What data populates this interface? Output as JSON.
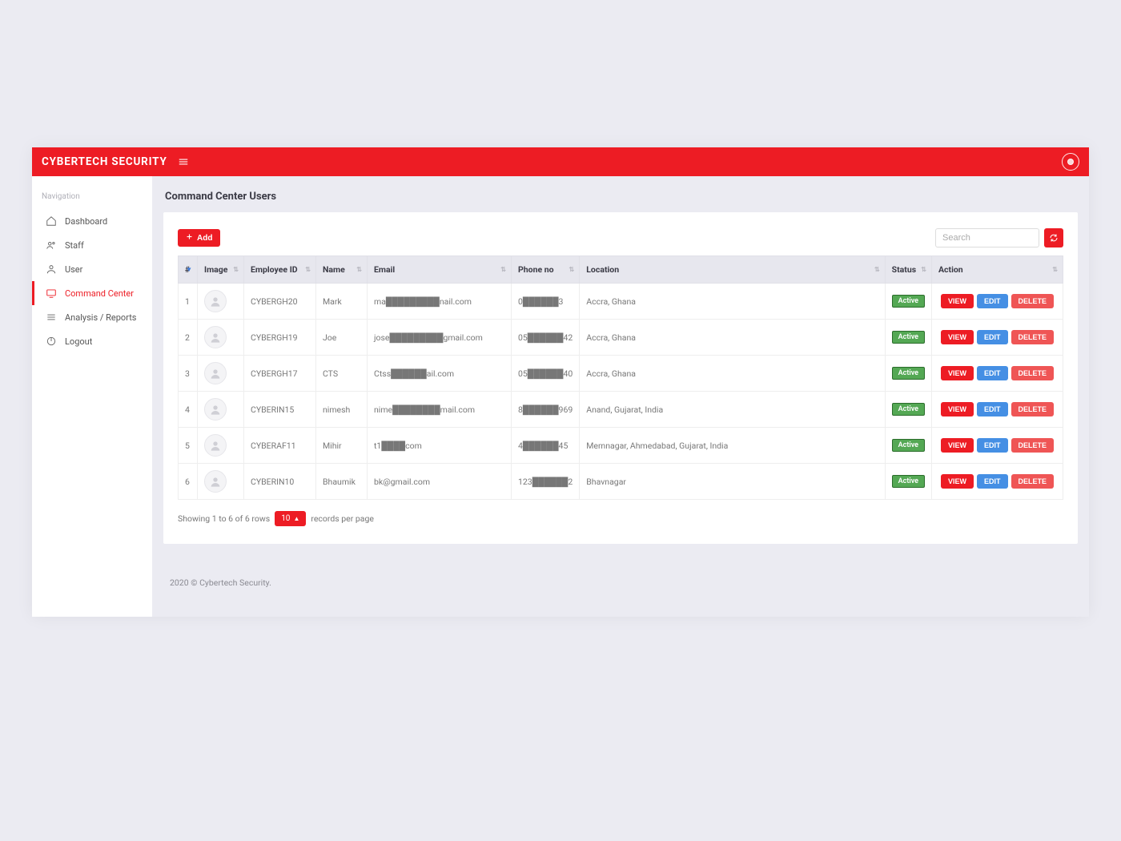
{
  "brand": "CYBERTECH SECURITY",
  "nav_header": "Navigation",
  "sidebar": {
    "items": [
      {
        "label": "Dashboard"
      },
      {
        "label": "Staff"
      },
      {
        "label": "User"
      },
      {
        "label": "Command Center"
      },
      {
        "label": "Analysis / Reports"
      },
      {
        "label": "Logout"
      }
    ]
  },
  "page_title": "Command Center Users",
  "toolbar": {
    "add_label": "Add",
    "search_placeholder": "Search"
  },
  "columns": {
    "num": "#",
    "image": "Image",
    "employee_id": "Employee ID",
    "name": "Name",
    "email": "Email",
    "phone": "Phone no",
    "location": "Location",
    "status": "Status",
    "action": "Action"
  },
  "action_labels": {
    "view": "VIEW",
    "edit": "EDIT",
    "delete": "DELETE"
  },
  "status_label": "Active",
  "rows": [
    {
      "num": "1",
      "emp": "CYBERGH20",
      "name": "Mark",
      "email": "ma█████████nail.com",
      "phone": "0██████3",
      "location": "Accra, Ghana"
    },
    {
      "num": "2",
      "emp": "CYBERGH19",
      "name": "Joe",
      "email": "jose█████████gmail.com",
      "phone": "05██████42",
      "location": "Accra, Ghana"
    },
    {
      "num": "3",
      "emp": "CYBERGH17",
      "name": "CTS",
      "email": "Ctss██████ail.com",
      "phone": "05██████40",
      "location": "Accra, Ghana"
    },
    {
      "num": "4",
      "emp": "CYBERIN15",
      "name": "nimesh",
      "email": "nime████████mail.com",
      "phone": "8██████969",
      "location": "Anand, Gujarat, India"
    },
    {
      "num": "5",
      "emp": "CYBERAF11",
      "name": "Mihir",
      "email": "t1████com",
      "phone": "4██████45",
      "location": "Memnagar, Ahmedabad, Gujarat, India"
    },
    {
      "num": "6",
      "emp": "CYBERIN10",
      "name": "Bhaumik",
      "email": "bk@gmail.com",
      "phone": "123██████2",
      "location": "Bhavnagar"
    }
  ],
  "footer": {
    "showing": "Showing 1 to 6 of 6 rows",
    "page_size": "10",
    "records_suffix": "records per page"
  },
  "site_footer": "2020 © Cybertech Security."
}
